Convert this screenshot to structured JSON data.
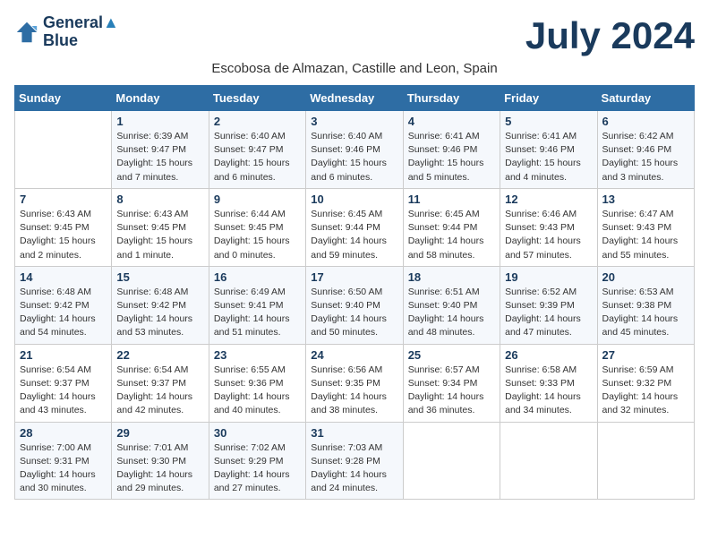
{
  "logo": {
    "line1": "General",
    "line2": "Blue"
  },
  "title": "July 2024",
  "subtitle": "Escobosa de Almazan, Castille and Leon, Spain",
  "headers": [
    "Sunday",
    "Monday",
    "Tuesday",
    "Wednesday",
    "Thursday",
    "Friday",
    "Saturday"
  ],
  "weeks": [
    [
      {
        "num": "",
        "info": ""
      },
      {
        "num": "1",
        "info": "Sunrise: 6:39 AM\nSunset: 9:47 PM\nDaylight: 15 hours\nand 7 minutes."
      },
      {
        "num": "2",
        "info": "Sunrise: 6:40 AM\nSunset: 9:47 PM\nDaylight: 15 hours\nand 6 minutes."
      },
      {
        "num": "3",
        "info": "Sunrise: 6:40 AM\nSunset: 9:46 PM\nDaylight: 15 hours\nand 6 minutes."
      },
      {
        "num": "4",
        "info": "Sunrise: 6:41 AM\nSunset: 9:46 PM\nDaylight: 15 hours\nand 5 minutes."
      },
      {
        "num": "5",
        "info": "Sunrise: 6:41 AM\nSunset: 9:46 PM\nDaylight: 15 hours\nand 4 minutes."
      },
      {
        "num": "6",
        "info": "Sunrise: 6:42 AM\nSunset: 9:46 PM\nDaylight: 15 hours\nand 3 minutes."
      }
    ],
    [
      {
        "num": "7",
        "info": "Sunrise: 6:43 AM\nSunset: 9:45 PM\nDaylight: 15 hours\nand 2 minutes."
      },
      {
        "num": "8",
        "info": "Sunrise: 6:43 AM\nSunset: 9:45 PM\nDaylight: 15 hours\nand 1 minute."
      },
      {
        "num": "9",
        "info": "Sunrise: 6:44 AM\nSunset: 9:45 PM\nDaylight: 15 hours\nand 0 minutes."
      },
      {
        "num": "10",
        "info": "Sunrise: 6:45 AM\nSunset: 9:44 PM\nDaylight: 14 hours\nand 59 minutes."
      },
      {
        "num": "11",
        "info": "Sunrise: 6:45 AM\nSunset: 9:44 PM\nDaylight: 14 hours\nand 58 minutes."
      },
      {
        "num": "12",
        "info": "Sunrise: 6:46 AM\nSunset: 9:43 PM\nDaylight: 14 hours\nand 57 minutes."
      },
      {
        "num": "13",
        "info": "Sunrise: 6:47 AM\nSunset: 9:43 PM\nDaylight: 14 hours\nand 55 minutes."
      }
    ],
    [
      {
        "num": "14",
        "info": "Sunrise: 6:48 AM\nSunset: 9:42 PM\nDaylight: 14 hours\nand 54 minutes."
      },
      {
        "num": "15",
        "info": "Sunrise: 6:48 AM\nSunset: 9:42 PM\nDaylight: 14 hours\nand 53 minutes."
      },
      {
        "num": "16",
        "info": "Sunrise: 6:49 AM\nSunset: 9:41 PM\nDaylight: 14 hours\nand 51 minutes."
      },
      {
        "num": "17",
        "info": "Sunrise: 6:50 AM\nSunset: 9:40 PM\nDaylight: 14 hours\nand 50 minutes."
      },
      {
        "num": "18",
        "info": "Sunrise: 6:51 AM\nSunset: 9:40 PM\nDaylight: 14 hours\nand 48 minutes."
      },
      {
        "num": "19",
        "info": "Sunrise: 6:52 AM\nSunset: 9:39 PM\nDaylight: 14 hours\nand 47 minutes."
      },
      {
        "num": "20",
        "info": "Sunrise: 6:53 AM\nSunset: 9:38 PM\nDaylight: 14 hours\nand 45 minutes."
      }
    ],
    [
      {
        "num": "21",
        "info": "Sunrise: 6:54 AM\nSunset: 9:37 PM\nDaylight: 14 hours\nand 43 minutes."
      },
      {
        "num": "22",
        "info": "Sunrise: 6:54 AM\nSunset: 9:37 PM\nDaylight: 14 hours\nand 42 minutes."
      },
      {
        "num": "23",
        "info": "Sunrise: 6:55 AM\nSunset: 9:36 PM\nDaylight: 14 hours\nand 40 minutes."
      },
      {
        "num": "24",
        "info": "Sunrise: 6:56 AM\nSunset: 9:35 PM\nDaylight: 14 hours\nand 38 minutes."
      },
      {
        "num": "25",
        "info": "Sunrise: 6:57 AM\nSunset: 9:34 PM\nDaylight: 14 hours\nand 36 minutes."
      },
      {
        "num": "26",
        "info": "Sunrise: 6:58 AM\nSunset: 9:33 PM\nDaylight: 14 hours\nand 34 minutes."
      },
      {
        "num": "27",
        "info": "Sunrise: 6:59 AM\nSunset: 9:32 PM\nDaylight: 14 hours\nand 32 minutes."
      }
    ],
    [
      {
        "num": "28",
        "info": "Sunrise: 7:00 AM\nSunset: 9:31 PM\nDaylight: 14 hours\nand 30 minutes."
      },
      {
        "num": "29",
        "info": "Sunrise: 7:01 AM\nSunset: 9:30 PM\nDaylight: 14 hours\nand 29 minutes."
      },
      {
        "num": "30",
        "info": "Sunrise: 7:02 AM\nSunset: 9:29 PM\nDaylight: 14 hours\nand 27 minutes."
      },
      {
        "num": "31",
        "info": "Sunrise: 7:03 AM\nSunset: 9:28 PM\nDaylight: 14 hours\nand 24 minutes."
      },
      {
        "num": "",
        "info": ""
      },
      {
        "num": "",
        "info": ""
      },
      {
        "num": "",
        "info": ""
      }
    ]
  ]
}
